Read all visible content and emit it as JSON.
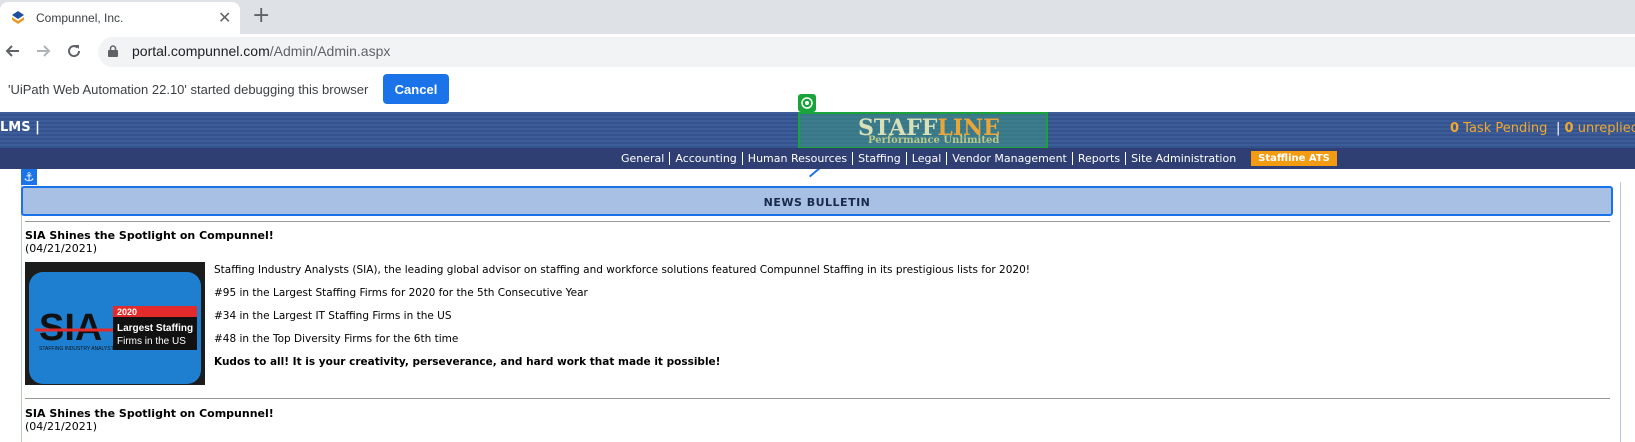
{
  "browser": {
    "tab_title": "Compunnel, Inc.",
    "tab_close": "✕",
    "new_tab": "+",
    "url_host": "portal.compunnel.com",
    "url_path": "/Admin/Admin.aspx"
  },
  "infobar": {
    "message": "'UiPath Web Automation 22.10' started debugging this browser",
    "cancel_label": "Cancel"
  },
  "header": {
    "left_label": "LMS  |",
    "task_count": "0",
    "task_label": " Task Pending",
    "unreplied_sep": "|",
    "unreplied_count": "0",
    "unreplied_label": " unreplied",
    "logo_staff": "STAFF",
    "logo_line": "LINE",
    "logo_tagline": "Performance Unlimited"
  },
  "nav": {
    "items": [
      "General",
      "Accounting",
      "Human Resources",
      "Staffing",
      "Legal",
      "Vendor Management",
      "Reports",
      "Site Administration"
    ],
    "ats_label": "Staffline ATS"
  },
  "news": {
    "header": "NEWS BULLETIN",
    "posts": [
      {
        "title": "SIA Shines the Spotlight on Compunnel!",
        "date": "(04/21/2021)",
        "lines": [
          "Staffing Industry Analysts (SIA), the leading global advisor on staffing and workforce solutions featured Compunnel Staffing in its prestigious lists for 2020!",
          "#95 in the Largest Staffing Firms for 2020 for the 5th Consecutive Year",
          "#34 in the Largest IT Staffing Firms in the US",
          "#48 in the Top Diversity Firms for the 6th time",
          "Kudos to all! It is your creativity, perseverance, and hard work that made it possible!"
        ],
        "image": {
          "logo": "SIA",
          "logo_sub": "STAFFING INDUSTRY ANALYSTS",
          "year": "2020",
          "caption_1": "Largest Staffing",
          "caption_2": "Firms in the US"
        }
      },
      {
        "title": "SIA Shines the Spotlight on Compunnel!",
        "date": "(04/21/2021)"
      }
    ]
  },
  "colors": {
    "header_blue": "#3d5d99",
    "nav_blue": "#2f3f73",
    "accent_orange": "#f39c12",
    "chrome_blue": "#1a73e8"
  }
}
